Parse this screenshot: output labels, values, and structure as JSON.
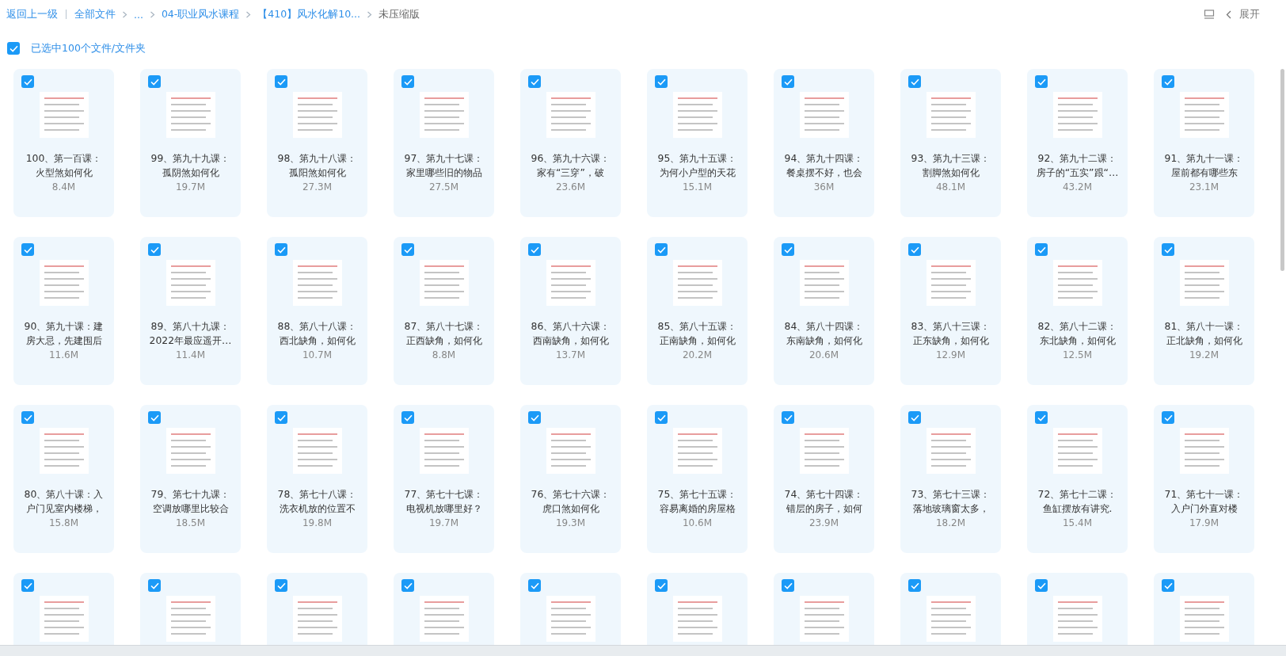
{
  "breadcrumb": {
    "back": "返回上一级",
    "items": [
      "全部文件",
      "...",
      "04-职业风水课程",
      "【410】风水化解10..."
    ],
    "current": "未压缩版"
  },
  "toolbar": {
    "expand": "展开"
  },
  "selection": {
    "checked": true,
    "label": "已选中100个文件/文件夹"
  },
  "files": [
    {
      "checked": true,
      "lines": [
        "100、第一百课：",
        "火型煞如何化"
      ],
      "size": "8.4M"
    },
    {
      "checked": true,
      "lines": [
        "99、第九十九课：",
        "孤阴煞如何化"
      ],
      "size": "19.7M"
    },
    {
      "checked": true,
      "lines": [
        "98、第九十八课：",
        "孤阳煞如何化"
      ],
      "size": "27.3M"
    },
    {
      "checked": true,
      "lines": [
        "97、第九十七课：",
        "家里哪些旧的物品"
      ],
      "size": "27.5M"
    },
    {
      "checked": true,
      "lines": [
        "96、第九十六课：",
        "家有“三穿”，破"
      ],
      "size": "23.6M"
    },
    {
      "checked": true,
      "lines": [
        "95、第九十五课：",
        "为何小户型的天花"
      ],
      "size": "15.1M"
    },
    {
      "checked": true,
      "lines": [
        "94、第九十四课：",
        "餐桌摆不好，也会"
      ],
      "size": "36M"
    },
    {
      "checked": true,
      "lines": [
        "93、第九十三课：",
        "割脚煞如何化"
      ],
      "size": "48.1M"
    },
    {
      "checked": true,
      "lines": [
        "92、第九十二课：",
        "房子的“五实”跟“…"
      ],
      "size": "43.2M"
    },
    {
      "checked": true,
      "lines": [
        "91、第九十一课：",
        "屋前都有哪些东"
      ],
      "size": "23.1M"
    },
    {
      "checked": true,
      "lines": [
        "90、第九十课：建",
        "房大忌，先建围后"
      ],
      "size": "11.6M"
    },
    {
      "checked": true,
      "lines": [
        "89、第八十九课：",
        "2022年最应遥开…"
      ],
      "size": "11.4M"
    },
    {
      "checked": true,
      "lines": [
        "88、第八十八课：",
        "西北缺角，如何化"
      ],
      "size": "10.7M"
    },
    {
      "checked": true,
      "lines": [
        "87、第八十七课：",
        "正西缺角，如何化"
      ],
      "size": "8.8M"
    },
    {
      "checked": true,
      "lines": [
        "86、第八十六课：",
        "西南缺角，如何化"
      ],
      "size": "13.7M"
    },
    {
      "checked": true,
      "lines": [
        "85、第八十五课：",
        "正南缺角，如何化"
      ],
      "size": "20.2M"
    },
    {
      "checked": true,
      "lines": [
        "84、第八十四课：",
        "东南缺角，如何化"
      ],
      "size": "20.6M"
    },
    {
      "checked": true,
      "lines": [
        "83、第八十三课：",
        "正东缺角，如何化"
      ],
      "size": "12.9M"
    },
    {
      "checked": true,
      "lines": [
        "82、第八十二课：",
        "东北缺角，如何化"
      ],
      "size": "12.5M"
    },
    {
      "checked": true,
      "lines": [
        "81、第八十一课：",
        "正北缺角，如何化"
      ],
      "size": "19.2M"
    },
    {
      "checked": true,
      "lines": [
        "80、第八十课：入",
        "户门见室内楼梯，"
      ],
      "size": "15.8M"
    },
    {
      "checked": true,
      "lines": [
        "79、第七十九课：",
        "空调放哪里比较合"
      ],
      "size": "18.5M"
    },
    {
      "checked": true,
      "lines": [
        "78、第七十八课：",
        "洗衣机放的位置不"
      ],
      "size": "19.8M"
    },
    {
      "checked": true,
      "lines": [
        "77、第七十七课：",
        "电视机放哪里好？"
      ],
      "size": "19.7M"
    },
    {
      "checked": true,
      "lines": [
        "76、第七十六课：",
        "虎口煞如何化"
      ],
      "size": "19.3M"
    },
    {
      "checked": true,
      "lines": [
        "75、第七十五课：",
        "容易离婚的房屋格"
      ],
      "size": "10.6M"
    },
    {
      "checked": true,
      "lines": [
        "74、第七十四课：",
        "错层的房子，如何"
      ],
      "size": "23.9M"
    },
    {
      "checked": true,
      "lines": [
        "73、第七十三课：",
        "落地玻璃窗太多，"
      ],
      "size": "18.2M"
    },
    {
      "checked": true,
      "lines": [
        "72、第七十二课：",
        "鱼缸摆放有讲究."
      ],
      "size": "15.4M"
    },
    {
      "checked": true,
      "lines": [
        "71、第七十一课：",
        "入户门外直对楼"
      ],
      "size": "17.9M"
    },
    {
      "checked": true
    },
    {
      "checked": true
    },
    {
      "checked": true
    },
    {
      "checked": true
    },
    {
      "checked": true
    },
    {
      "checked": true
    },
    {
      "checked": true
    },
    {
      "checked": true
    },
    {
      "checked": true
    },
    {
      "checked": true
    }
  ]
}
